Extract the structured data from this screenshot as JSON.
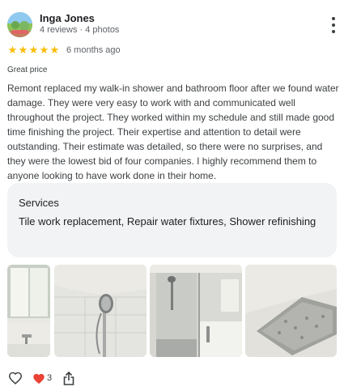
{
  "reviewer": {
    "name": "Inga Jones",
    "meta": "4 reviews · 4 photos"
  },
  "rating": {
    "stars": 5,
    "max_stars": 5,
    "star_glyph": "★",
    "time_ago": "6 months ago"
  },
  "tag": "Great price",
  "review_text": "Remont replaced my walk-in shower and bathroom floor after we found water damage. They were very easy to work with and communicated well throughout the project. They worked within my schedule and still made good time finishing the project. Their expertise and attention to detail were outstanding. Their estimate was detailed, so there were no surprises, and they were the lowest bid of four companies. I highly recommend them to anyone looking to have work done in their home.",
  "services": {
    "title": "Services",
    "list": "Tile work replacement, Repair water fixtures, Shower refinishing"
  },
  "photos": [
    {
      "subject": "bathroom-window-tub-photo"
    },
    {
      "subject": "shower-head-photo"
    },
    {
      "subject": "glass-shower-enclosure-photo"
    },
    {
      "subject": "shower-floor-tile-photo"
    }
  ],
  "actions": {
    "like_icon": "heart-outline-icon",
    "reaction_icon": "red-heart-icon",
    "reaction_count": "3",
    "share_icon": "share-icon"
  },
  "colors": {
    "star": "#fbbc04",
    "heart": "#ea4335",
    "services_bg": "#f1f3f4"
  }
}
